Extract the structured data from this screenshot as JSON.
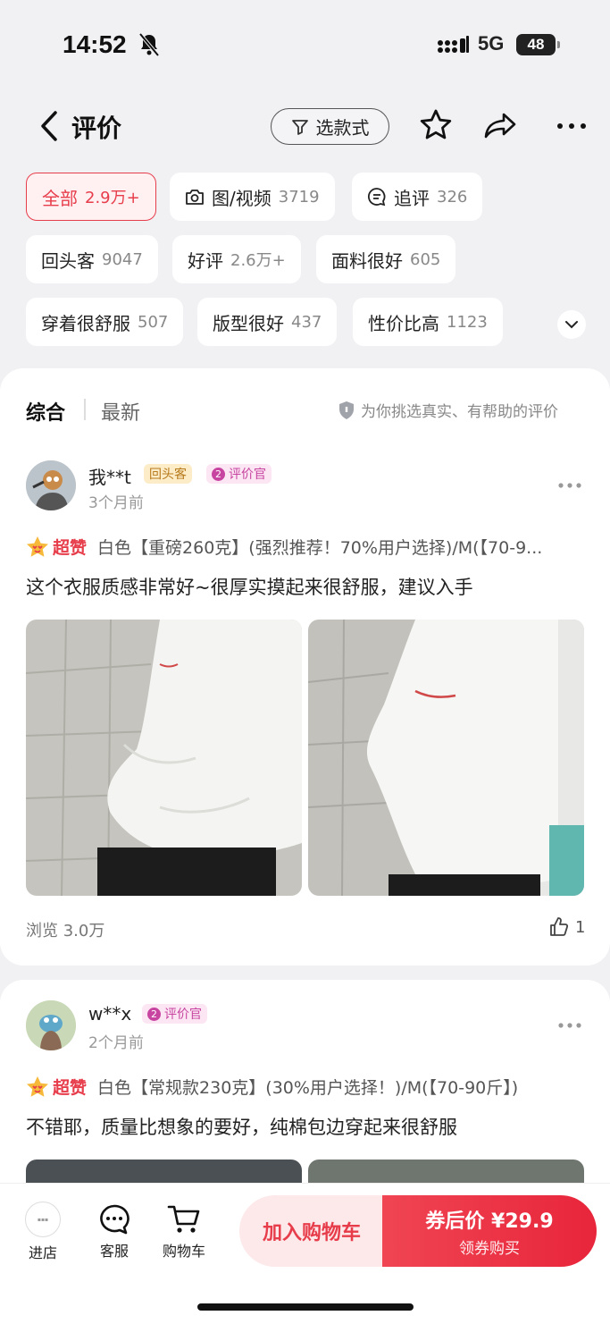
{
  "status_bar": {
    "time": "14:52",
    "network": "5G",
    "battery": "48"
  },
  "header": {
    "title": "评价",
    "style_filter_label": "选款式"
  },
  "filter_chips": [
    {
      "label": "全部",
      "count": "2.9万+",
      "active": true
    },
    {
      "label": "图/视频",
      "count": "3719",
      "icon": "camera-icon"
    },
    {
      "label": "追评",
      "count": "326",
      "icon": "comment-icon"
    },
    {
      "label": "回头客",
      "count": "9047"
    },
    {
      "label": "好评",
      "count": "2.6万+"
    },
    {
      "label": "面料很好",
      "count": "605"
    },
    {
      "label": "穿着很舒服",
      "count": "507"
    },
    {
      "label": "版型很好",
      "count": "437"
    },
    {
      "label": "性价比高",
      "count": "1123"
    }
  ],
  "sort": {
    "primary": "综合",
    "secondary": "最新",
    "tip": "为你挑选真实、有帮助的评价"
  },
  "reviews": [
    {
      "user": "我**t",
      "badges": [
        "回头客",
        "评价官"
      ],
      "reviewer_level": "2",
      "time": "3个月前",
      "rating_label": "超赞",
      "spec": "白色【重磅260克】(强烈推荐！70%用户选择)/M(【70-9...",
      "content": "这个衣服质感非常好~很厚实摸起来很舒服，建议入手",
      "views": "浏览 3.0万",
      "likes": "1"
    },
    {
      "user": "w**x",
      "badges": [
        "评价官"
      ],
      "reviewer_level": "2",
      "time": "2个月前",
      "rating_label": "超赞",
      "spec": "白色【常规款230克】(30%用户选择！)/M(【70-90斤】)",
      "content": "不错耶，质量比想象的要好，纯棉包边穿起来很舒服"
    }
  ],
  "bottom_bar": {
    "store_label": "进店",
    "service_label": "客服",
    "cart_label": "购物车",
    "add_to_cart": "加入购物车",
    "buy_price": "券后价 ¥29.9",
    "buy_sub": "领券购买",
    "accent": "#e73d4b"
  }
}
